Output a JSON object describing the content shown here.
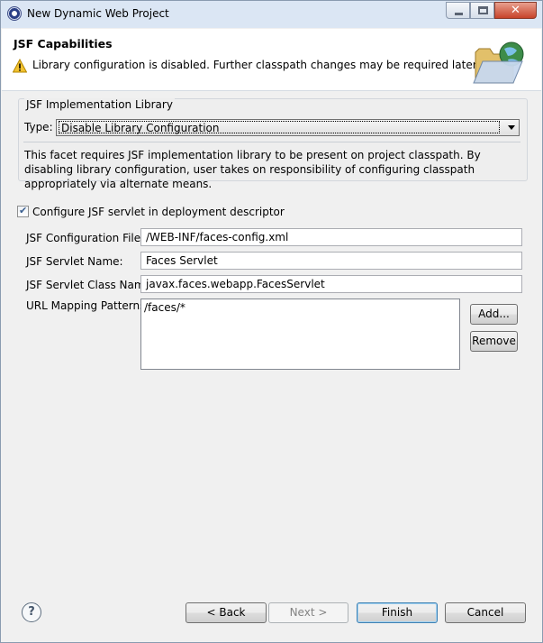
{
  "window": {
    "title": "New Dynamic Web Project",
    "controls": {
      "minimize": "minimize-icon",
      "maximize": "maximize-icon",
      "close": "close-icon"
    }
  },
  "header": {
    "title": "JSF Capabilities",
    "message": "Library configuration is disabled. Further classpath changes may be required later.",
    "message_icon": "warning-icon",
    "banner_icon": "folder-globe-icon"
  },
  "implementation_group": {
    "label": "JSF Implementation Library",
    "type_label": "Type:",
    "type_value": "Disable Library Configuration",
    "description": "This facet requires JSF implementation library to be present on project classpath. By disabling library configuration, user takes on responsibility of configuring classpath appropriately via alternate means."
  },
  "servlet": {
    "configure_checkbox_label": "Configure JSF servlet in deployment descriptor",
    "configure_checked": true,
    "config_file_label": "JSF Configuration File:",
    "config_file_value": "/WEB-INF/faces-config.xml",
    "servlet_name_label": "JSF Servlet Name:",
    "servlet_name_value": "Faces Servlet",
    "servlet_class_label": "JSF Servlet Class Name:",
    "servlet_class_value": "javax.faces.webapp.FacesServlet",
    "url_patterns_label": "URL Mapping Patterns:",
    "url_patterns": [
      "/faces/*"
    ],
    "add_button": "Add...",
    "remove_button": "Remove"
  },
  "footer": {
    "help_icon": "help-icon",
    "back_button": "< Back",
    "next_button": "Next >",
    "finish_button": "Finish",
    "cancel_button": "Cancel"
  },
  "colors": {
    "titlebar": "#dbe6f4",
    "dialog_background": "#f0f0f0",
    "header_background": "#ffffff",
    "close_button": "#c7432a"
  }
}
